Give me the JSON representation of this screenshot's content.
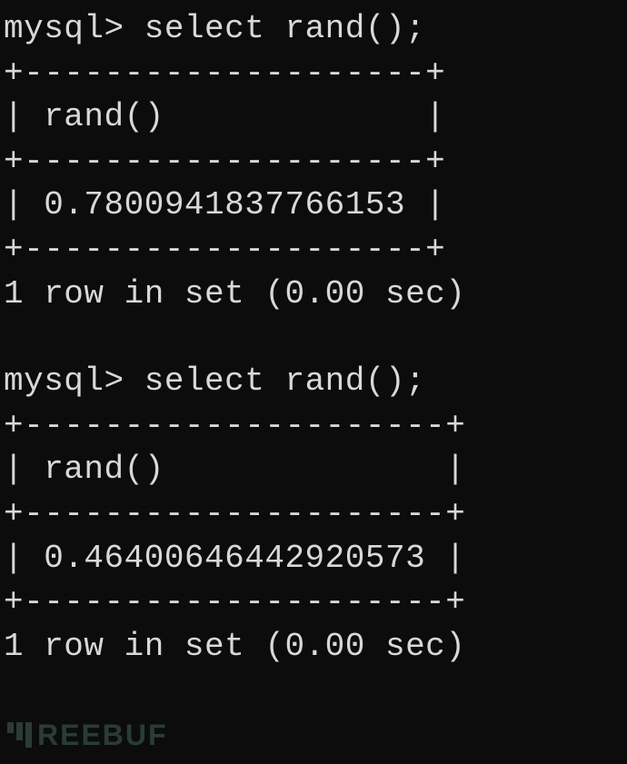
{
  "query1": {
    "prompt": "mysql> ",
    "command": "select rand();",
    "border_top": "+--------------------+",
    "header_line": "| rand()             |",
    "border_mid": "+--------------------+",
    "value_line": "| 0.7800941837766153 |",
    "border_bot": "+--------------------+",
    "status": "1 row in set (0.00 sec)"
  },
  "query2": {
    "prompt": "mysql> ",
    "command": "select rand();",
    "border_top": "+---------------------+",
    "header_line": "| rand()              |",
    "border_mid": "+---------------------+",
    "value_line": "| 0.46400646442920573 |",
    "border_bot": "+---------------------+",
    "status": "1 row in set (0.00 sec)"
  },
  "watermark": "REEBUF"
}
